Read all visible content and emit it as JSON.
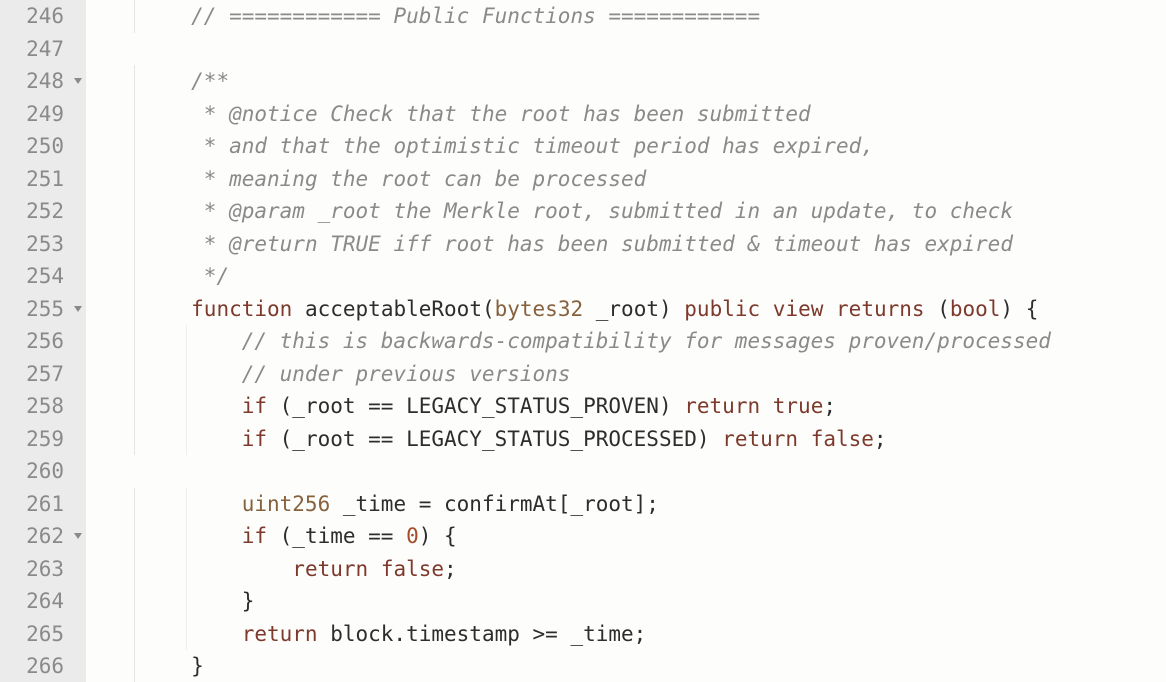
{
  "lines": [
    {
      "num": "246",
      "fold": false,
      "indent": 2,
      "tokens": [
        [
          "c-comment",
          "// ============ Public Functions ============"
        ]
      ]
    },
    {
      "num": "247",
      "fold": false,
      "indent": 0,
      "tokens": []
    },
    {
      "num": "248",
      "fold": true,
      "indent": 2,
      "tokens": [
        [
          "c-comment",
          "/**"
        ]
      ]
    },
    {
      "num": "249",
      "fold": false,
      "indent": 2,
      "tokens": [
        [
          "c-comment",
          " * @notice Check that the root has been submitted"
        ]
      ]
    },
    {
      "num": "250",
      "fold": false,
      "indent": 2,
      "tokens": [
        [
          "c-comment",
          " * and that the optimistic timeout period has expired,"
        ]
      ]
    },
    {
      "num": "251",
      "fold": false,
      "indent": 2,
      "tokens": [
        [
          "c-comment",
          " * meaning the root can be processed"
        ]
      ]
    },
    {
      "num": "252",
      "fold": false,
      "indent": 2,
      "tokens": [
        [
          "c-comment",
          " * @param _root the Merkle root, submitted in an update, to check"
        ]
      ]
    },
    {
      "num": "253",
      "fold": false,
      "indent": 2,
      "tokens": [
        [
          "c-comment",
          " * @return TRUE iff root has been submitted & timeout has expired"
        ]
      ]
    },
    {
      "num": "254",
      "fold": false,
      "indent": 2,
      "tokens": [
        [
          "c-comment",
          " */"
        ]
      ]
    },
    {
      "num": "255",
      "fold": true,
      "indent": 2,
      "tokens": [
        [
          "c-keyword",
          "function"
        ],
        [
          "c-plain",
          " acceptableRoot("
        ],
        [
          "c-type",
          "bytes32"
        ],
        [
          "c-plain",
          " _root) "
        ],
        [
          "c-keyword",
          "public"
        ],
        [
          "c-plain",
          " "
        ],
        [
          "c-keyword",
          "view"
        ],
        [
          "c-plain",
          " "
        ],
        [
          "c-keyword",
          "returns"
        ],
        [
          "c-plain",
          " ("
        ],
        [
          "c-keyword",
          "bool"
        ],
        [
          "c-plain",
          ") {"
        ]
      ]
    },
    {
      "num": "256",
      "fold": false,
      "indent": 3,
      "tokens": [
        [
          "c-comment",
          "// this is backwards-compatibility for messages proven/processed"
        ]
      ]
    },
    {
      "num": "257",
      "fold": false,
      "indent": 3,
      "tokens": [
        [
          "c-comment",
          "// under previous versions"
        ]
      ]
    },
    {
      "num": "258",
      "fold": false,
      "indent": 3,
      "tokens": [
        [
          "c-keyword",
          "if"
        ],
        [
          "c-plain",
          " (_root == LEGACY_STATUS_PROVEN) "
        ],
        [
          "c-keyword",
          "return"
        ],
        [
          "c-plain",
          " "
        ],
        [
          "c-keyword",
          "true"
        ],
        [
          "c-plain",
          ";"
        ]
      ]
    },
    {
      "num": "259",
      "fold": false,
      "indent": 3,
      "tokens": [
        [
          "c-keyword",
          "if"
        ],
        [
          "c-plain",
          " (_root == LEGACY_STATUS_PROCESSED) "
        ],
        [
          "c-keyword",
          "return"
        ],
        [
          "c-plain",
          " "
        ],
        [
          "c-keyword",
          "false"
        ],
        [
          "c-plain",
          ";"
        ]
      ]
    },
    {
      "num": "260",
      "fold": false,
      "indent": 0,
      "tokens": []
    },
    {
      "num": "261",
      "fold": false,
      "indent": 3,
      "tokens": [
        [
          "c-type",
          "uint256"
        ],
        [
          "c-plain",
          " _time = confirmAt[_root];"
        ]
      ]
    },
    {
      "num": "262",
      "fold": true,
      "indent": 3,
      "tokens": [
        [
          "c-keyword",
          "if"
        ],
        [
          "c-plain",
          " (_time == "
        ],
        [
          "c-num",
          "0"
        ],
        [
          "c-plain",
          ") {"
        ]
      ]
    },
    {
      "num": "263",
      "fold": false,
      "indent": 4,
      "tokens": [
        [
          "c-keyword",
          "return"
        ],
        [
          "c-plain",
          " "
        ],
        [
          "c-keyword",
          "false"
        ],
        [
          "c-plain",
          ";"
        ]
      ]
    },
    {
      "num": "264",
      "fold": false,
      "indent": 3,
      "tokens": [
        [
          "c-plain",
          "}"
        ]
      ]
    },
    {
      "num": "265",
      "fold": false,
      "indent": 3,
      "tokens": [
        [
          "c-keyword",
          "return"
        ],
        [
          "c-plain",
          " block.timestamp >= _time;"
        ]
      ]
    },
    {
      "num": "266",
      "fold": false,
      "indent": 2,
      "tokens": [
        [
          "c-plain",
          "}"
        ]
      ]
    }
  ],
  "indent_unit": "    "
}
